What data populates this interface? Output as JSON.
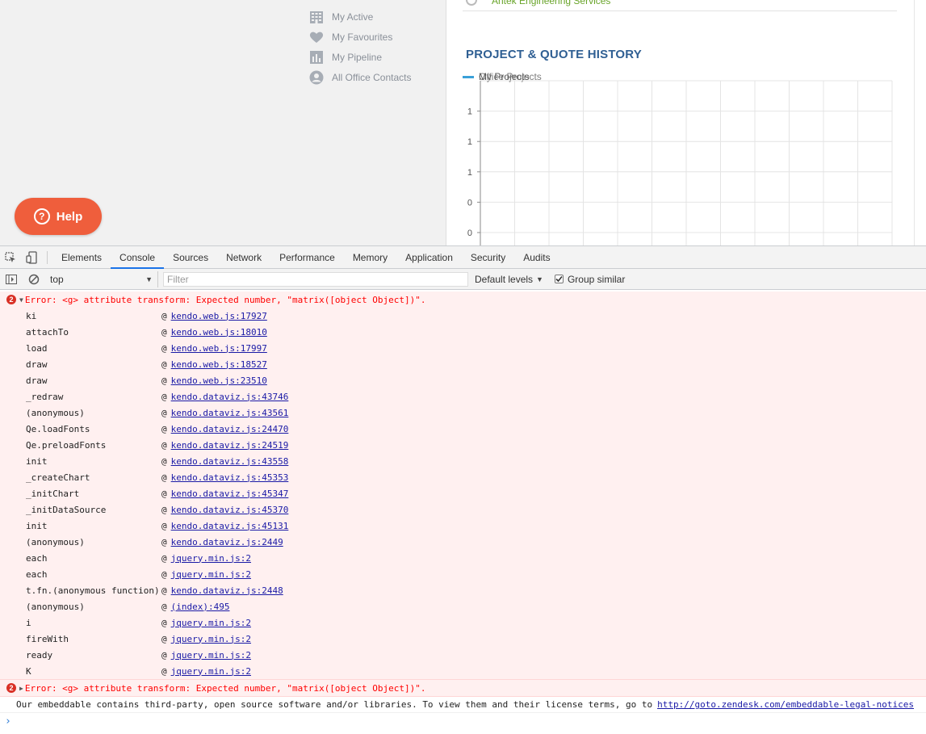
{
  "page": {
    "quick_links": [
      {
        "label": "My Active",
        "icon": "building-icon"
      },
      {
        "label": "My Favourites",
        "icon": "heart-icon"
      },
      {
        "label": "My Pipeline",
        "icon": "bar-chart-icon"
      },
      {
        "label": "All Office Contacts",
        "icon": "user-icon"
      }
    ],
    "help_button": {
      "label": "Help"
    },
    "top_company": "Antek Engineering Services",
    "section_title": "PROJECT & QUOTE HISTORY",
    "legend": {
      "label_a": "My Projects",
      "label_b": "Office Projects"
    },
    "colors": {
      "accent": "#2f5f93",
      "legend": "#3aa0d8",
      "help": "#ef5e3c",
      "company": "#69a42a"
    }
  },
  "chart_data": {
    "type": "line",
    "y_tick_labels": [
      "1",
      "1",
      "1",
      "0",
      "0"
    ],
    "grid": true,
    "series": [
      {
        "name": "My Projects",
        "values": []
      },
      {
        "name": "Office Projects",
        "values": []
      }
    ]
  },
  "devtools": {
    "tabs": [
      "Elements",
      "Console",
      "Sources",
      "Network",
      "Performance",
      "Memory",
      "Application",
      "Security",
      "Audits"
    ],
    "active_tab": "Console",
    "context": "top",
    "filter_placeholder": "Filter",
    "levels": "Default levels",
    "group_similar": "Group similar",
    "error_count_1": "2",
    "error_count_2": "2",
    "error_message": "Error: <g> attribute transform: Expected number, \"matrix([object Object])\".",
    "stack": [
      {
        "fn": "ki",
        "loc": "kendo.web.js:17927"
      },
      {
        "fn": "attachTo",
        "loc": "kendo.web.js:18010"
      },
      {
        "fn": "load",
        "loc": "kendo.web.js:17997"
      },
      {
        "fn": "draw",
        "loc": "kendo.web.js:18527"
      },
      {
        "fn": "draw",
        "loc": "kendo.web.js:23510"
      },
      {
        "fn": "_redraw",
        "loc": "kendo.dataviz.js:43746"
      },
      {
        "fn": "(anonymous)",
        "loc": "kendo.dataviz.js:43561"
      },
      {
        "fn": "Qe.loadFonts",
        "loc": "kendo.dataviz.js:24470"
      },
      {
        "fn": "Qe.preloadFonts",
        "loc": "kendo.dataviz.js:24519"
      },
      {
        "fn": "init",
        "loc": "kendo.dataviz.js:43558"
      },
      {
        "fn": "_createChart",
        "loc": "kendo.dataviz.js:45353"
      },
      {
        "fn": "_initChart",
        "loc": "kendo.dataviz.js:45347"
      },
      {
        "fn": "_initDataSource",
        "loc": "kendo.dataviz.js:45370"
      },
      {
        "fn": "init",
        "loc": "kendo.dataviz.js:45131"
      },
      {
        "fn": "(anonymous)",
        "loc": "kendo.dataviz.js:2449"
      },
      {
        "fn": "each",
        "loc": "jquery.min.js:2"
      },
      {
        "fn": "each",
        "loc": "jquery.min.js:2"
      },
      {
        "fn": "t.fn.(anonymous function)",
        "loc": "kendo.dataviz.js:2448"
      },
      {
        "fn": "(anonymous)",
        "loc": "(index):495"
      },
      {
        "fn": "i",
        "loc": "jquery.min.js:2"
      },
      {
        "fn": "fireWith",
        "loc": "jquery.min.js:2"
      },
      {
        "fn": "ready",
        "loc": "jquery.min.js:2"
      },
      {
        "fn": "K",
        "loc": "jquery.min.js:2"
      }
    ],
    "info_text": "Our embeddable contains third-party, open source software and/or libraries. To view them and their license terms, go to",
    "info_link": "http://goto.zendesk.com/embeddable-legal-notices",
    "at_symbol": "@",
    "prompt": "›"
  }
}
